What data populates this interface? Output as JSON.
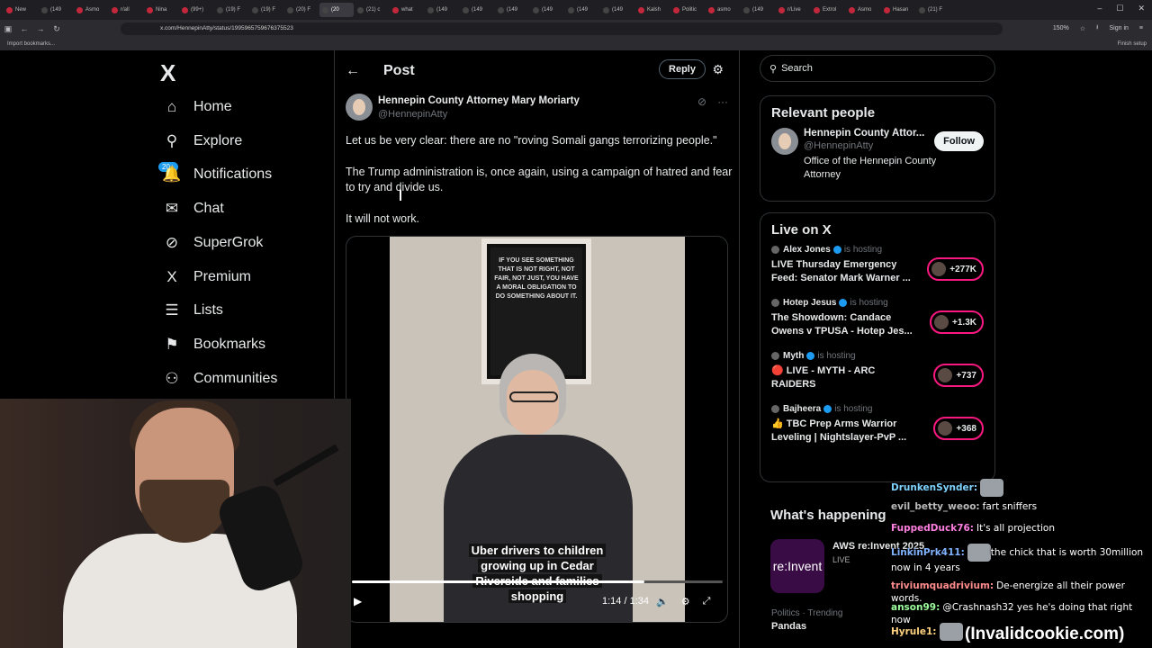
{
  "browser": {
    "tabs": [
      {
        "label": "New",
        "active": false
      },
      {
        "label": "(149",
        "active": false
      },
      {
        "label": "Asmo",
        "active": false
      },
      {
        "label": "r/all",
        "active": false
      },
      {
        "label": "Nina",
        "active": false
      },
      {
        "label": "(99+)",
        "active": false
      },
      {
        "label": "(19) F",
        "active": false
      },
      {
        "label": "(19) F",
        "active": false
      },
      {
        "label": "(20) F",
        "active": false
      },
      {
        "label": "(20",
        "active": true
      },
      {
        "label": "(21) c",
        "active": false
      },
      {
        "label": "what",
        "active": false
      },
      {
        "label": "(149",
        "active": false
      },
      {
        "label": "(149",
        "active": false
      },
      {
        "label": "(149",
        "active": false
      },
      {
        "label": "(149",
        "active": false
      },
      {
        "label": "(149",
        "active": false
      },
      {
        "label": "(149",
        "active": false
      },
      {
        "label": "Kalsh",
        "active": false
      },
      {
        "label": "Politic",
        "active": false
      },
      {
        "label": "asmo",
        "active": false
      },
      {
        "label": "(149",
        "active": false
      },
      {
        "label": "r/Live",
        "active": false
      },
      {
        "label": "Extrol",
        "active": false
      },
      {
        "label": "Asmo",
        "active": false
      },
      {
        "label": "Hasan",
        "active": false
      },
      {
        "label": "(21) F",
        "active": false
      }
    ],
    "url": "x.com/HennepinAtty/status/1995965759676375523",
    "zoom": "150%",
    "sign_in": "Sign in",
    "import_bookmarks": "Import bookmarks...",
    "finish_setup": "Finish setup"
  },
  "sidebar": {
    "logo": "X",
    "badge": "20+",
    "items": [
      {
        "label": "Home",
        "icon": "home-icon",
        "glyph": "⌂"
      },
      {
        "label": "Explore",
        "icon": "search-icon",
        "glyph": "⚲"
      },
      {
        "label": "Notifications",
        "icon": "bell-icon",
        "glyph": "🔔"
      },
      {
        "label": "Chat",
        "icon": "mail-icon",
        "glyph": "✉"
      },
      {
        "label": "SuperGrok",
        "icon": "grok-icon",
        "glyph": "⊘"
      },
      {
        "label": "Premium",
        "icon": "x-premium-icon",
        "glyph": "X"
      },
      {
        "label": "Lists",
        "icon": "lists-icon",
        "glyph": "☰"
      },
      {
        "label": "Bookmarks",
        "icon": "bookmark-icon",
        "glyph": "⚑"
      },
      {
        "label": "Communities",
        "icon": "communities-icon",
        "glyph": "⚇"
      }
    ]
  },
  "post": {
    "header_title": "Post",
    "reply_label": "Reply",
    "author_name": "Hennepin County Attorney Mary Moriarty",
    "author_handle": "@HennepinAtty",
    "paragraphs": [
      "Let us be very clear: there are no \"roving Somali gangs terrorizing people.\"",
      "The Trump administration is, once again, using a campaign of hatred and fear to try and divide us.",
      "It will not work."
    ],
    "video": {
      "frame_text": "IF YOU SEE SOMETHING THAT IS NOT RIGHT, NOT FAIR, NOT JUST, YOU HAVE A MORAL OBLIGATION TO DO SOMETHING ABOUT IT.",
      "subtitle_lines": [
        "Uber drivers to children",
        "growing up in Cedar",
        "Riverside and families",
        "shopping"
      ],
      "time": "1:14 / 1:34",
      "progress": 0.79
    }
  },
  "right": {
    "search_placeholder": "Search",
    "relevant_title": "Relevant people",
    "relevant_person": {
      "name": "Hennepin County Attor...",
      "handle": "@HennepinAtty",
      "bio": "Office of the Hennepin County Attorney",
      "follow_label": "Follow"
    },
    "live_title": "Live on X",
    "live_items": [
      {
        "host": "Alex Jones",
        "status": "is hosting",
        "title": "LIVE Thursday Emergency Feed: Senator Mark Warner ...",
        "count": "+277K"
      },
      {
        "host": "Hotep Jesus",
        "status": "is hosting",
        "title": "The Showdown: Candace Owens v TPUSA - Hotep Jes...",
        "count": "+1.3K"
      },
      {
        "host": "Myth",
        "status": "is hosting",
        "title": "🔴 LIVE - MYTH - ARC RAIDERS",
        "count": "+737"
      },
      {
        "host": "Bajheera",
        "status": "is hosting",
        "title": "👍 TBC Prep Arms Warrior Leveling | Nightslayer-PvP ...",
        "count": "+368"
      }
    ],
    "happening_title": "What's happening",
    "happening_item": {
      "title": "AWS re:Invent 2025",
      "sub": "LIVE",
      "image_text": "re:Invent"
    },
    "trend": {
      "category": "Politics · Trending",
      "name": "Pandas"
    }
  },
  "chat": [
    {
      "user": "DrunkenSynder:",
      "color": "#7fd3ff",
      "text": ""
    },
    {
      "user": "evil_betty_weoo:",
      "color": "#bbbbbb",
      "text": "fart sniffers"
    },
    {
      "user": "FuppedDuck76:",
      "color": "#ff7fe0",
      "text": "It's all projection"
    },
    {
      "user": "LinkinPrk411:",
      "color": "#7fb2ff",
      "text": "the chick that is worth 30million now in 4 years"
    },
    {
      "user": "triviumquadrivium:",
      "color": "#ff8c8c",
      "text": "De-energize all their power words."
    },
    {
      "user": "anson99:",
      "color": "#9dff9d",
      "text": "@Crashnash32 yes he's doing that right now"
    },
    {
      "user": "Hyrule1:",
      "color": "#ffd27f",
      "text": ""
    }
  ],
  "watermark": "(Invalidcookie.com)"
}
